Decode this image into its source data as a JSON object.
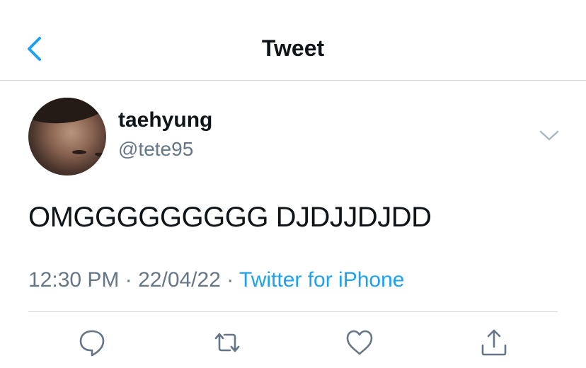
{
  "nav": {
    "title": "Tweet"
  },
  "tweet": {
    "author": {
      "display_name": "taehyung",
      "handle": "@tete95"
    },
    "text": "OMGGGGGGGGG DJDJJDJDD",
    "time": "12:30 PM",
    "date": "22/04/22",
    "source": "Twitter for iPhone"
  },
  "actions": [
    "reply-icon",
    "retweet-icon",
    "like-icon",
    "share-icon"
  ],
  "colors": {
    "accent": "#1da1f2",
    "muted": "#657786",
    "text": "#0f1419",
    "divider": "#d6d9dc"
  }
}
